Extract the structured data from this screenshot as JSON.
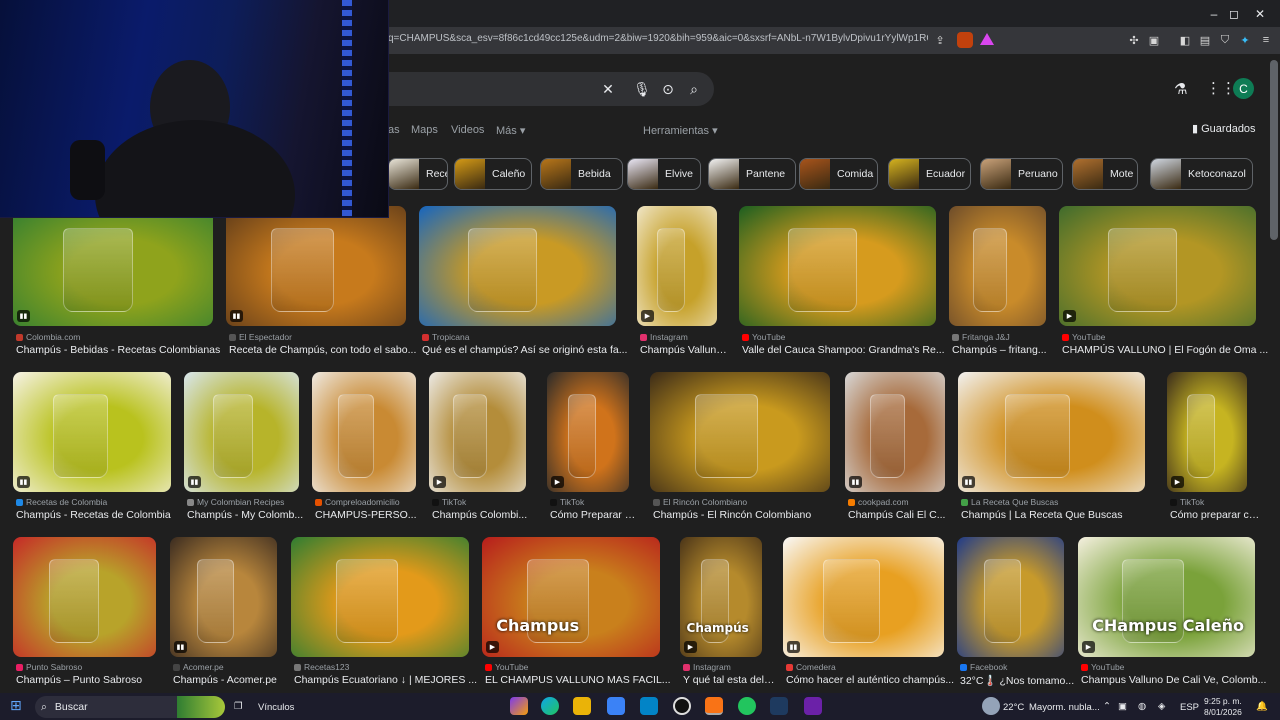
{
  "browser": {
    "url": "q=CHAMPUS&sca_esv=8f86c1cd49cc125e&udm=2&biw=1920&bih=959&aic=0&sxsrf=ANbL-n7W1BylvDpivu1rYylWp1RQfXZb...",
    "window_controls": [
      "–",
      "◻",
      "✕"
    ]
  },
  "nav": {
    "tabs": [
      "as",
      "Maps",
      "Videos",
      "Más ▾"
    ],
    "tools": "Herramientas ▾",
    "saved": "Guardados",
    "avatar_letter": "C"
  },
  "chips": [
    {
      "label": "Receta",
      "color": "#e8e4d8"
    },
    {
      "label": "Caleño",
      "color": "#d49a16"
    },
    {
      "label": "Bebida",
      "color": "#b8761a"
    },
    {
      "label": "Elvive",
      "color": "#e9e6f4"
    },
    {
      "label": "Pantene",
      "color": "#f2f2f2"
    },
    {
      "label": "Comida",
      "color": "#a8541b"
    },
    {
      "label": "Ecuador",
      "color": "#d5b31f"
    },
    {
      "label": "Peruano",
      "color": "#c9a27a"
    },
    {
      "label": "Mote",
      "color": "#b0702f"
    },
    {
      "label": "Ketoconazol",
      "color": "#cfd6e0"
    }
  ],
  "results_row1": [
    {
      "source": "Colombia.com",
      "title": "Champús - Bebidas - Recetas Colombianas",
      "color": "#8fa31c",
      "accent": "#2e7d32",
      "icon": "#c0392b",
      "badge": "recipe-icon"
    },
    {
      "source": "El Espectador",
      "title": "Receta de Champús, con todo el sabo...",
      "color": "#c77a1c",
      "accent": "#5d3a1a",
      "icon": "#555",
      "badge": "recipe-icon"
    },
    {
      "source": "Tropicana",
      "title": "Qué es el champús? Así se originó esta fa...",
      "color": "#c99a24",
      "accent": "#1565c0",
      "icon": "#d32f2f",
      "badge": ""
    },
    {
      "source": "Instagram",
      "title": "Champús Valluno ...",
      "color": "#c6a12a",
      "accent": "#f0e6c8",
      "icon": "#e1306c",
      "badge": "play-icon"
    },
    {
      "source": "YouTube",
      "title": "Valle del Cauca Shampoo: Grandma's Re...",
      "color": "#d69b1e",
      "accent": "#1b5e20",
      "icon": "#ff0000",
      "badge": ""
    },
    {
      "source": "Fritanga J&J",
      "title": "Champús – fritang...",
      "color": "#c98b2a",
      "accent": "#6d4c2a",
      "icon": "#777",
      "badge": ""
    },
    {
      "source": "YouTube",
      "title": "CHAMPÚS VALLUNO | El Fogón de Oma ...",
      "color": "#b39624",
      "accent": "#3e6b2d",
      "icon": "#ff0000",
      "badge": "play-icon"
    }
  ],
  "results_row2": [
    {
      "source": "Recetas de Colombia",
      "title": "Champús - Recetas de Colombia",
      "color": "#b9c21e",
      "accent": "#f7f3e8",
      "icon": "#1e88e5",
      "badge": "recipe-icon"
    },
    {
      "source": "My Colombian Recipes",
      "title": "Champús - My Colomb...",
      "color": "#b7b42a",
      "accent": "#d9e7ef",
      "icon": "#888",
      "badge": "recipe-icon"
    },
    {
      "source": "Compreloadomicilio",
      "title": "CHAMPUS-PERSO...",
      "color": "#c98a33",
      "accent": "#efeae3",
      "icon": "#e65100",
      "badge": ""
    },
    {
      "source": "TikTok",
      "title": "Champús Colombi...",
      "color": "#b48d3a",
      "accent": "#eceae6",
      "icon": "#111",
      "badge": "play-icon"
    },
    {
      "source": "TikTok",
      "title": "Cómo Preparar Ch...",
      "color": "#d0731b",
      "accent": "#2a2a2a",
      "icon": "#111",
      "badge": "play-icon"
    },
    {
      "source": "El Rincón Colombiano",
      "title": "Champús - El Rincón Colombiano",
      "color": "#c99a1e",
      "accent": "#3a2a18",
      "icon": "#555",
      "badge": ""
    },
    {
      "source": "cookpad.com",
      "title": "Champús Cali El C...",
      "color": "#a76a3a",
      "accent": "#d8d8d8",
      "icon": "#f57c00",
      "badge": "recipe-icon"
    },
    {
      "source": "La Receta Que Buscas",
      "title": "Champús | La Receta Que Buscas",
      "color": "#d08e1c",
      "accent": "#f2f2f2",
      "icon": "#43a047",
      "badge": "recipe-icon"
    },
    {
      "source": "TikTok",
      "title": "Cómo preparar ch...",
      "color": "#c6b421",
      "accent": "#3a2c1c",
      "icon": "#111",
      "badge": "play-icon"
    }
  ],
  "results_row3": [
    {
      "source": "Punto Sabroso",
      "title": "Champús – Punto Sabroso",
      "color": "#b8a32a",
      "accent": "#c62828",
      "icon": "#e91e63",
      "badge": ""
    },
    {
      "source": "Acomer.pe",
      "title": "Champús - Acomer.pe",
      "color": "#b8863c",
      "accent": "#3a2b20",
      "icon": "#444",
      "badge": "recipe-icon"
    },
    {
      "source": "Recetas123",
      "title": "Champús Ecuatoriano ↓ | MEJORES ...",
      "color": "#e39a1a",
      "accent": "#2e7d32",
      "icon": "#777",
      "badge": ""
    },
    {
      "source": "YouTube",
      "title": "EL CHAMPUS VALLUNO MAS FACIL...",
      "color": "#c9801c",
      "accent": "#b71c1c",
      "icon": "#ff0000",
      "badge": "play-icon",
      "overlay": "Champus"
    },
    {
      "source": "Instagram",
      "title": "Y qué tal esta delic...",
      "color": "#b58a2c",
      "accent": "#4a3418",
      "icon": "#e1306c",
      "badge": "play-icon",
      "overlay": "Champús"
    },
    {
      "source": "Comedera",
      "title": "Cómo hacer el auténtico champús...",
      "color": "#e8a021",
      "accent": "#f9f9f9",
      "icon": "#e53935",
      "badge": "recipe-icon"
    },
    {
      "source": "Facebook",
      "title": "32°C🌡️ ¿Nos tomamo...",
      "color": "#c79a2b",
      "accent": "#1e3a8a",
      "icon": "#1877f2",
      "badge": ""
    },
    {
      "source": "YouTube",
      "title": "Champus Valluno De Cali Ve, Colomb...",
      "color": "#7aa23a",
      "accent": "#f5f0e0",
      "icon": "#ff0000",
      "badge": "play-icon",
      "overlay": "CHampus Caleño"
    }
  ],
  "taskbar": {
    "search": "Buscar",
    "widget": "Vínculos",
    "weather_temp": "22°C",
    "weather_desc": "Mayorm. nubla...",
    "lang": "ESP",
    "time": "9:25 p. m.",
    "date": "8/01/2026"
  }
}
